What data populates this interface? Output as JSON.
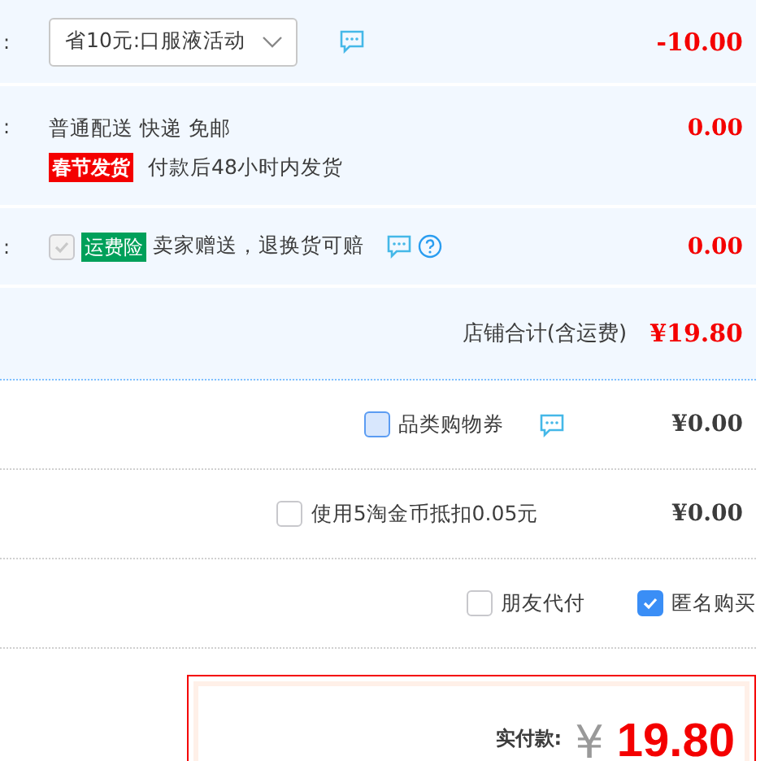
{
  "promotion": {
    "label": ":",
    "selection": "省10元:口服液活动",
    "amount": "-10.00"
  },
  "delivery": {
    "label": ":",
    "method": "普通配送 快递 免邮",
    "badge": "春节发货",
    "note": "付款后48小时内发货",
    "amount": "0.00"
  },
  "insurance": {
    "label": ":",
    "checked": true,
    "disabled": true,
    "badge": "运费险",
    "text": "卖家赠送，退换货可赔",
    "amount": "0.00"
  },
  "shop_total": {
    "label": "店铺合计(含运费)",
    "amount": "¥19.80"
  },
  "discounts": [
    {
      "kind": "voucher",
      "label": "品类购物券",
      "checked": false,
      "focused": true,
      "amount": "¥0.00"
    },
    {
      "kind": "coins",
      "label": "使用5淘金币抵扣0.05元",
      "checked": false,
      "focused": false,
      "amount": "¥0.00"
    }
  ],
  "options": [
    {
      "label": "朋友代付",
      "checked": false
    },
    {
      "label": "匿名购买",
      "checked": true
    }
  ],
  "payment": {
    "label": "实付款:",
    "currency": "¥",
    "amount": "19.80"
  }
}
